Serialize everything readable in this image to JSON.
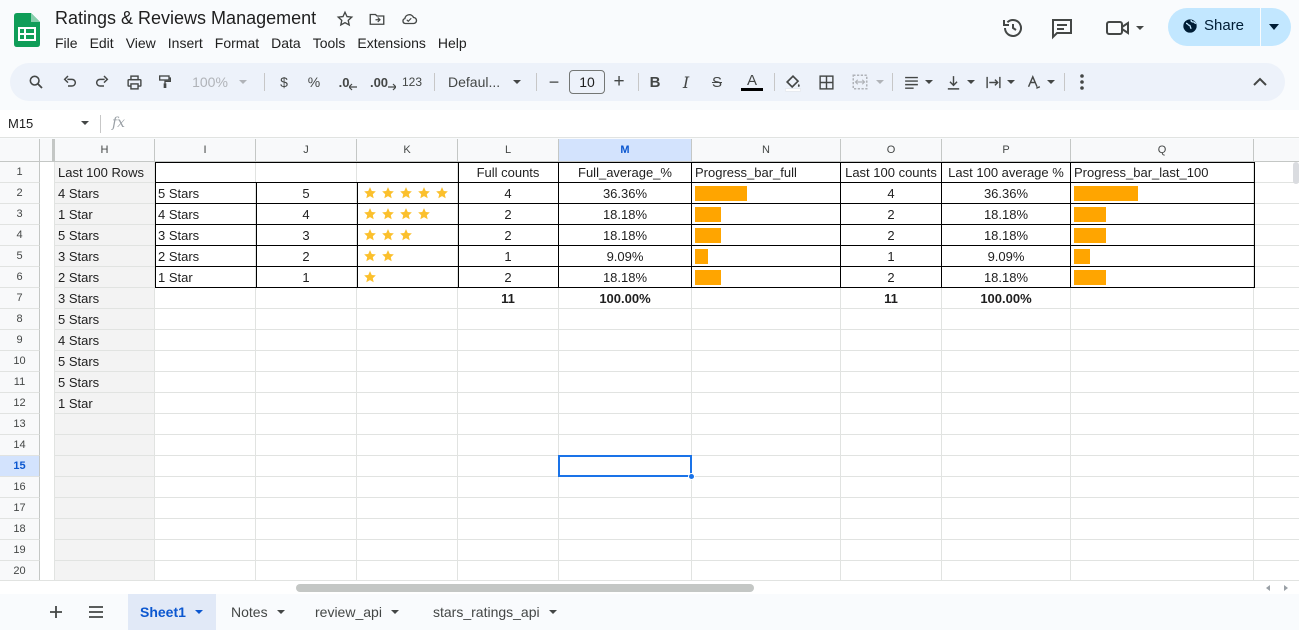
{
  "app": {
    "title": "Ratings & Reviews Management",
    "menu": [
      "File",
      "Edit",
      "View",
      "Insert",
      "Format",
      "Data",
      "Tools",
      "Extensions",
      "Help"
    ],
    "share_label": "Share",
    "brand_color": "#0f9d58",
    "accent_color": "#c2e7ff"
  },
  "toolbar": {
    "zoom": "100%",
    "currency": "$",
    "percent": "%",
    "dec_decrease": ".0",
    "dec_increase": ".00",
    "number_format": "123",
    "font": "Defaul...",
    "font_size": "10",
    "minus": "−",
    "plus": "+",
    "bold": "B",
    "italic": "I",
    "strike": "S",
    "text_color": "A"
  },
  "formula_bar": {
    "name_box": "M15",
    "fx": "fx",
    "content": ""
  },
  "columns": [
    "H",
    "I",
    "J",
    "K",
    "L",
    "M",
    "N",
    "O",
    "P",
    "Q"
  ],
  "rows": [
    "1",
    "2",
    "3",
    "4",
    "5",
    "6",
    "7",
    "8",
    "9",
    "10",
    "11",
    "12",
    "13",
    "14",
    "15",
    "16",
    "17",
    "18",
    "19",
    "20"
  ],
  "selected": {
    "col": "M",
    "row": "15"
  },
  "cells": {
    "H": [
      "Last 100 Rows",
      "4 Stars",
      "1 Star",
      "5 Stars",
      "3 Stars",
      "2 Stars",
      "3 Stars",
      "5 Stars",
      "4 Stars",
      "5 Stars",
      "5 Stars",
      "1 Star"
    ],
    "I": [
      "",
      "5 Stars",
      "4 Stars",
      "3 Stars",
      "2 Stars",
      "1 Star"
    ],
    "J": [
      "",
      "5",
      "4",
      "3",
      "2",
      "1"
    ],
    "L": [
      "Full counts",
      "4",
      "2",
      "2",
      "1",
      "2",
      "11"
    ],
    "M": [
      "Full_average_%",
      "36.36%",
      "18.18%",
      "18.18%",
      "9.09%",
      "18.18%",
      "100.00%"
    ],
    "N": [
      "Progress_bar_full"
    ],
    "O": [
      "Last 100 counts",
      "4",
      "2",
      "2",
      "1",
      "2",
      "11"
    ],
    "P": [
      "Last 100 average %",
      "36.36%",
      "18.18%",
      "18.18%",
      "9.09%",
      "18.18%",
      "100.00%"
    ],
    "Q": [
      "Progress_bar_last_100"
    ]
  },
  "stars_per_row": [
    5,
    4,
    3,
    2,
    1
  ],
  "progress_full": [
    0.3636,
    0.1818,
    0.1818,
    0.0909,
    0.1818
  ],
  "progress_last_100": [
    0.3636,
    0.1818,
    0.1818,
    0.0909,
    0.1818
  ],
  "bar_color": "#ffa500",
  "star_color": "#fbc02d",
  "sheets": [
    {
      "name": "Sheet1",
      "active": true
    },
    {
      "name": "Notes",
      "active": false
    },
    {
      "name": "review_api",
      "active": false
    },
    {
      "name": "stars_ratings_api",
      "active": false
    }
  ]
}
